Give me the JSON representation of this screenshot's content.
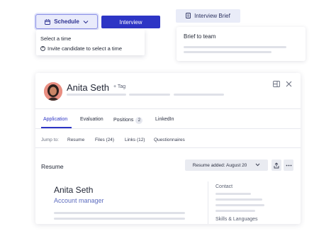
{
  "schedule": {
    "button_label": "Schedule",
    "calendar_icon": "calendar-icon",
    "chevron_icon": "chevron-down-icon",
    "menu": {
      "items": [
        "Select a time",
        "Invite candidate to select a time"
      ]
    }
  },
  "interview": {
    "button_label": "Interview"
  },
  "brief": {
    "button_label": "Interview Brief",
    "card_title": "Brief to team"
  },
  "profile": {
    "name": "Anita Seth",
    "tag_label": "+ Tag",
    "tabs": [
      {
        "label": "Application",
        "active": true
      },
      {
        "label": "Evaluation"
      },
      {
        "label": "Positions",
        "count": "2"
      },
      {
        "label": "LinkedIn"
      }
    ],
    "jump": {
      "label": "Jump to:",
      "links": [
        "Resume",
        "Files (24)",
        "Links (12)",
        "Questionnaires"
      ]
    },
    "resume": {
      "title": "Resume",
      "select_label": "Resume added: August 20"
    },
    "cv": {
      "name": "Anita Seth",
      "role": "Account manager"
    },
    "side": {
      "contact_label": "Contact",
      "skills_label": "Skills & Languages"
    }
  },
  "colors": {
    "primary": "#2d35c5",
    "accent_light": "#e9ebfb",
    "muted_bar": "#dfe1e8",
    "role_text": "#5d6cbf"
  }
}
